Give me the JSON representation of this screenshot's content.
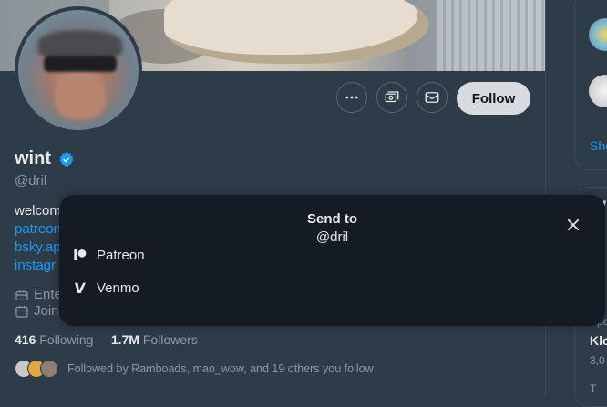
{
  "profile": {
    "name": "wint",
    "handle": "@dril",
    "bio_line1": "welcom",
    "link1": "patreon",
    "link2": "bsky.ap",
    "link3": "instagr",
    "meta_entertainment": "Ente",
    "meta_joined": "Join",
    "following_count": "416",
    "following_label": "Following",
    "followers_count": "1.7M",
    "followers_label": "Followers",
    "followed_by": "Followed by Ramboads, mao_wow, and 19 others you follow"
  },
  "actions": {
    "follow_label": "Follow",
    "more_icon": "more-horizontal-icon",
    "subscribe_icon": "subscribe-money-icon",
    "message_icon": "envelope-icon"
  },
  "modal": {
    "title": "Send to",
    "subtitle": "@dril",
    "options": [
      {
        "label": "Patreon",
        "icon": "patreon-icon"
      },
      {
        "label": "Venmo",
        "icon": "venmo-icon"
      }
    ]
  },
  "sidebar": {
    "show_more": "Sho",
    "card2_partial": "W",
    "sponsored_partial": "Spo",
    "trend_partial": "Klo",
    "count_partial": "3,0",
    "next_partial": "T"
  },
  "colors": {
    "background": "#2e3b48",
    "modal": "#141b24",
    "link": "#1d9bf0",
    "verified": "#1d9bf0",
    "follow_button": "#d7dbdf"
  }
}
